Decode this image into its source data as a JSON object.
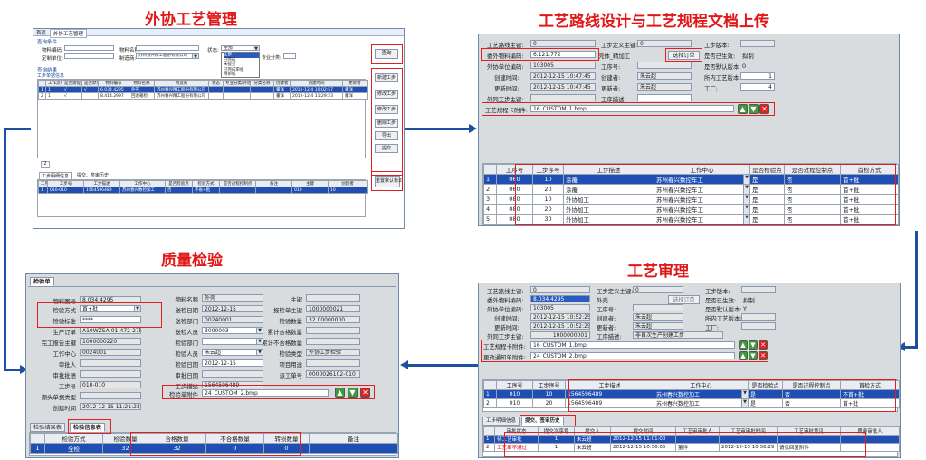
{
  "titles": {
    "outsourcing": "外协工艺管理",
    "route_design": "工艺路线设计与工艺规程文档上传",
    "quality": "质量检验",
    "review": "工艺审理"
  },
  "p1": {
    "tabs": [
      "首页",
      "外协工艺管理"
    ],
    "section_query": "查询条件",
    "section_list": "查询结果",
    "material_code_label": "物料编码:",
    "contractor_label": "定制单位:",
    "material_name_label": "物料名称:",
    "manufacturer_label": "制造商:",
    "manufacturer_value": "苏州春兴精工股份有限公司",
    "status_label": "状态:",
    "status_value": "全部",
    "status_options": [
      "全部",
      "已完成",
      "未提交",
      "已完成审核",
      "待审核"
    ],
    "category_label": "专业分类:",
    "query_btn": "查询",
    "grid_caption": "工步单据信息",
    "grid_headers": [
      "",
      "工作流单",
      "是否需提交",
      "是否默认",
      "物料编号",
      "物料名称",
      "制造商",
      "状态",
      "专业分类/外协",
      "分类名称",
      "创建者",
      "创建时间",
      "更新者"
    ],
    "grid_rows": [
      [
        "1",
        "1",
        "√",
        "√",
        "6.034.4295",
        "外壳",
        "苏州春兴精工股份有限公司",
        "",
        "",
        "",
        "董洋",
        "2012-12-4 10:02:57",
        "董洋"
      ],
      [
        "2",
        "1",
        "√",
        "",
        "8.414.2997",
        "回收箱检",
        "苏州春兴精工股份有限公司",
        "",
        "",
        "",
        "董洋",
        "2012-12-4 11:29:23",
        "董洋"
      ]
    ],
    "side_buttons": [
      "新建工步",
      "修改工步",
      "修改工步",
      "删除工步",
      "导出",
      "提交"
    ],
    "page_indicator": "2",
    "lower_tabs": [
      "工步明细信息",
      "提交、签审历史"
    ],
    "lower_headers": [
      "工序号",
      "工步号",
      "工步描述",
      "工作中心",
      "是否检验点",
      "检验方式",
      "是否过程控制点",
      "备注",
      "主键",
      "创建者"
    ],
    "lower_row": [
      "1",
      "010-010",
      "1564596489",
      "苏州春兴数控加工",
      "否",
      "不省+批",
      "",
      "",
      "010",
      "10"
    ],
    "redo_btn": "重置默认标识"
  },
  "p2": {
    "route_key_label": "工艺路线主键:",
    "route_key_value": "0",
    "step_def_key_label": "工步定义主键:",
    "step_def_key_value": "0",
    "step_version_label": "工步版本:",
    "outsource_code_label": "委外物料编码:",
    "outsource_code_value": "6.121.772",
    "outsource_code_value2": "壳体_精加工",
    "select_order_btn": "选择订单",
    "effective_label": "是否已生效:",
    "effective_value": "拟制",
    "unit_code_label": "外协单位编码:",
    "unit_code_value": "103005",
    "step_no_label": "工序号:",
    "default_version_label": "是否默认版本:",
    "default_version_value": "0",
    "created_label": "创建时间:",
    "created_value": "2012-12-15 10:47:45",
    "creator_label": "创建者:",
    "creator_value": "朱云超",
    "belong_version_label": "所内工艺版本:",
    "belong_version_value": "1",
    "updated_label": "更新时间:",
    "updated_value": "2012-12-15 10:47:45",
    "updater_label": "更新者:",
    "updater_value": "朱云超",
    "factory_label": "工厂:",
    "factory_value": "4",
    "out_key_label": "外同工步主键:",
    "step_desc_label": "工序描述:",
    "attach_label": "工艺规程卡附件:",
    "attach_value": "16_CUSTOM_1.bmp",
    "grid_headers": [
      "",
      "工序号",
      "工步序号",
      "工步描述",
      "工作中心",
      "是否检验点",
      "是否过程控制点",
      "首检方式"
    ],
    "grid_rows": [
      [
        "1",
        "060",
        "10",
        "涂覆",
        "苏州春兴数控车工",
        "是",
        "否",
        "首+批"
      ],
      [
        "2",
        "060",
        "20",
        "涂覆",
        "苏州春兴数控车工",
        "是",
        "否",
        "首+批"
      ],
      [
        "3",
        "080",
        "10",
        "外协加工",
        "苏州春兴数控车工",
        "是",
        "否",
        "首+批"
      ],
      [
        "4",
        "080",
        "20",
        "外协加工",
        "苏州春兴数控车工",
        "是",
        "否",
        "首+批"
      ],
      [
        "5",
        "080",
        "30",
        "外协加工",
        "苏州春兴数控车工",
        "是",
        "否",
        "首+批"
      ]
    ]
  },
  "p3": {
    "tab": "检验单",
    "material_no_label": "物料图号",
    "material_no_value": "8.034.4295",
    "material_name_label": "物料名称",
    "material_name_value": "外壳",
    "main_key_label": "主键",
    "inspect_mode_label": "检验方式",
    "inspect_mode_value": "首+批",
    "send_date_label": "送检日期",
    "send_date_value": "2012-12-15",
    "report_key_label": "报检单主键",
    "report_key_value": "1000000021",
    "inspect_std_label": "检验标准",
    "inspect_std_value": "****",
    "send_dept_label": "送检部门",
    "send_dept_value": "00240001",
    "inspect_qty_label": "检验数量",
    "inspect_qty_value": "32.00000000",
    "prod_order_label": "生产订单",
    "prod_order_value": "A10WZ5A-01-472-27ba",
    "send_person_label": "送检人员",
    "send_person_value": "3000003",
    "cum_qualified_label": "累计合格数量",
    "report_main_label": "完工报告主键",
    "report_main_value": "1000000220",
    "inspect_dept_label": "检验部门",
    "cum_unqualified_label": "累计不合格数量",
    "work_center_label": "工作中心",
    "work_center_value": "0024001",
    "inspector_label": "检验人员",
    "inspector_value": "朱云超",
    "inspect_type_label": "检验类型",
    "inspect_type_value": "外协工步检验",
    "reviewer_label": "审批人",
    "inspect_date_label": "检验日期",
    "inspect_date_value": "2012-12-15",
    "project_use_label": "项目用途",
    "review_comment_label": "审批批语",
    "review_date_label": "审批日期",
    "dispatch_no_label": "派工单号",
    "dispatch_no_value": "0000026102-010",
    "step_no_label": "工步号",
    "step_no_value": "010-010",
    "step_desc_label": "工步描述",
    "step_desc_value": "1564596489",
    "source_type_label": "源头单据类型",
    "attach_label": "检验单附件",
    "attach_value": "24_CUSTOM_2.bmp",
    "created_label": "创建时间",
    "created_value": "2012-12-15 11:21:23",
    "lower_tabs": [
      "检验结果表",
      "检验信息表"
    ],
    "grid_headers": [
      "",
      "检验方式",
      "检验数量",
      "合格数量",
      "不合格数量",
      "转损数量",
      "备注"
    ],
    "grid_row": [
      "1",
      "全检",
      "32",
      "32",
      "0",
      "0",
      ""
    ]
  },
  "p4": {
    "route_key_label": "工艺路线主键:",
    "route_key_value": "0",
    "step_def_key_label": "工步定义主键:",
    "step_def_key_value": "0",
    "step_version_label": "工步版本:",
    "outsource_code_label": "委外物料编码:",
    "outsource_code_value": "8.034.4295",
    "outsource_name_value": "外壳",
    "select_order_btn": "选择订单",
    "effective_label": "是否已生效:",
    "effective_value": "拟制",
    "unit_code_label": "外协单位编码:",
    "unit_code_value": "103005",
    "step_no_label": "工序号:",
    "default_version_label": "是否默认版本:",
    "default_version_value": "Y",
    "created_label": "创建时间:",
    "created_value": "2012-12-15 10:52:25",
    "creator_label": "创建者:",
    "creator_value": "朱云超",
    "belong_version_label": "所内工艺版本:",
    "updated_label": "更新时间:",
    "updated_value": "2012-12-15 10:52:25",
    "updater_label": "更新者:",
    "updater_value": "朱云超",
    "factory_label": "工厂:",
    "out_key_label": "外同工步主键:",
    "out_key_value": "1000000001",
    "step_desc_label": "工序描述:",
    "step_desc_value": "非首次生产创建工步",
    "attach1_label": "工艺规程卡附件:",
    "attach1_value": "16_CUSTOM_1.bmp",
    "attach2_label": "更改通知单附件:",
    "attach2_value": "24_CUSTOM_2.bmp",
    "grid_headers": [
      "",
      "工序号",
      "工步序号",
      "工步描述",
      "工作中心",
      "是否检验点",
      "是否过程控制点",
      "首检方式"
    ],
    "grid_rows": [
      [
        "1",
        "010",
        "10",
        "1564596489",
        "苏州春兴数控加工",
        "是",
        "否",
        "不首+批"
      ],
      [
        "2",
        "010",
        "20",
        "1564596489",
        "苏州春兴数控加工",
        "是",
        "否",
        "首+批"
      ]
    ],
    "lower_tabs": [
      "工步明细信息",
      "提交、签审历史"
    ],
    "hist_headers": [
      "",
      "审批状态",
      "提交次序号",
      "提交人",
      "提交时间",
      "工艺审审批人",
      "工艺审审批时间",
      "工艺审批意见",
      "质量审批人"
    ],
    "hist_rows": [
      [
        "1",
        "待工艺审批",
        "1",
        "朱云超",
        "2012-12-15 11:01:00",
        "",
        "",
        "",
        ""
      ],
      [
        "2",
        "工艺审不通过",
        "1",
        "朱云超",
        "2012-12-15 10:56:05",
        "董洋",
        "2012-12-15 10:58:29",
        "请见回复附件",
        ""
      ]
    ]
  }
}
